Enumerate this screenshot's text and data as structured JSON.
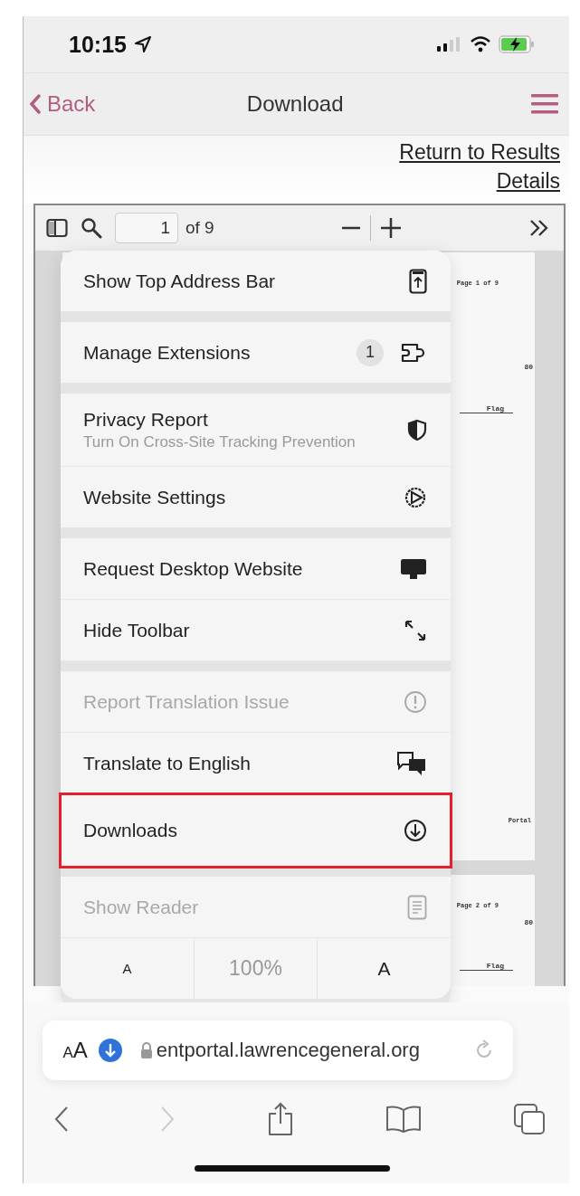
{
  "status_bar": {
    "time": "10:15"
  },
  "nav_bar": {
    "back": "Back",
    "title": "Download"
  },
  "links": [
    "Return to Results",
    "Details"
  ],
  "pdf_viewer": {
    "page_field": {
      "value": "1"
    },
    "page_count": "of 9",
    "pages": [
      {
        "fragments": [
          "Page 1 of 9",
          "80",
          "Flag",
          "Portal"
        ]
      },
      {
        "fragments": [
          "Page 2 of 9",
          "80",
          "Flag"
        ]
      }
    ]
  },
  "menu": {
    "sections": [
      [
        {
          "kind": "item",
          "label": "Show Top Address Bar",
          "disabled": false,
          "highlighted": false
        }
      ],
      [
        {
          "kind": "item",
          "label": "Manage Extensions",
          "badge": "1",
          "disabled": false,
          "highlighted": false
        }
      ],
      [
        {
          "kind": "item",
          "label": "Privacy Report",
          "subtitle": "Turn On Cross-Site Tracking Prevention",
          "disabled": false,
          "highlighted": false
        },
        {
          "kind": "item",
          "label": "Website Settings",
          "disabled": false,
          "highlighted": false
        }
      ],
      [
        {
          "kind": "item",
          "label": "Request Desktop Website",
          "disabled": false,
          "highlighted": false
        },
        {
          "kind": "item",
          "label": "Hide Toolbar",
          "disabled": false,
          "highlighted": false
        }
      ],
      [
        {
          "kind": "item",
          "label": "Report Translation Issue",
          "disabled": true,
          "highlighted": false
        },
        {
          "kind": "item",
          "label": "Translate to English",
          "disabled": false,
          "highlighted": false
        },
        {
          "kind": "item",
          "label": "Downloads",
          "disabled": false,
          "highlighted": true
        }
      ],
      [
        {
          "kind": "item",
          "label": "Show Reader",
          "disabled": true,
          "highlighted": false
        },
        {
          "kind": "font_controls",
          "smaller": "A",
          "zoom": "100%",
          "larger": "A"
        }
      ]
    ]
  },
  "address_bar": {
    "text_size": {
      "small": "A",
      "large": "A"
    },
    "url": "entportal.lawrencegeneral.org"
  },
  "toolbar": {
    "back_disabled": false,
    "forward_disabled": true
  }
}
